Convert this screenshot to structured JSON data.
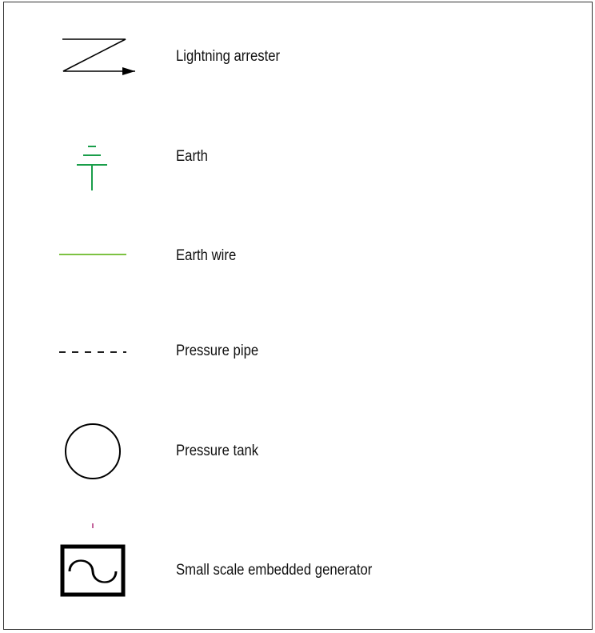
{
  "legend": {
    "items": [
      {
        "symbol": "lightning-arrester-icon",
        "label": "Lightning arrester",
        "color": "#000000"
      },
      {
        "symbol": "earth-icon",
        "label": "Earth",
        "color": "#1a9e4a"
      },
      {
        "symbol": "earth-wire-icon",
        "label": "Earth wire",
        "color": "#7dc242"
      },
      {
        "symbol": "pressure-pipe-icon",
        "label": "Pressure pipe",
        "color": "#000000"
      },
      {
        "symbol": "pressure-tank-icon",
        "label": "Pressure tank",
        "color": "#000000"
      },
      {
        "symbol": "small-scale-embedded-generator-icon",
        "label": "Small scale embedded generator",
        "color": "#000000",
        "accent": "#b0307a"
      }
    ]
  }
}
